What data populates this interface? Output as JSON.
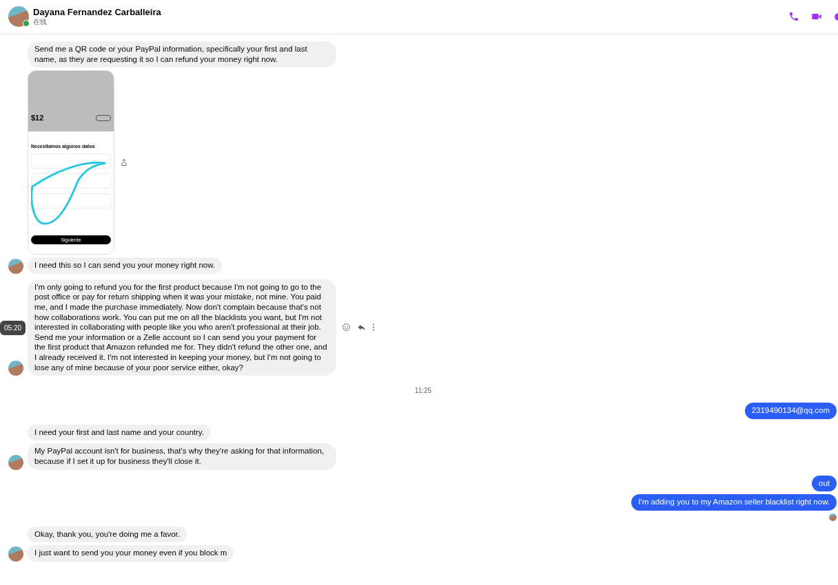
{
  "header": {
    "name": "Dayana Fernandez Carballeira",
    "status": "在线",
    "online": true
  },
  "messages": [
    {
      "kind": "text",
      "outgoing": false,
      "text": "Send me a QR code or your PayPal information, specifically your first and last name, as they are requesting it so I can refund your money right now.",
      "avatar": false
    },
    {
      "kind": "image",
      "outgoing": false,
      "price": "$12",
      "heading": "Necesitamos algunos datos",
      "button": "Siguiente",
      "avatar": false
    },
    {
      "kind": "text",
      "outgoing": false,
      "text": "I need this so I can send you your money right now.",
      "avatar": true
    },
    {
      "kind": "text",
      "outgoing": false,
      "text": "I'm only going to refund you for the first product because I'm not going to go to the post office or pay for return shipping when it was your mistake, not mine. You paid me, and I made the purchase immediately. Now don't complain because that's not how collaborations work. You can put me on all the blacklists you want, but I'm not interested in collaborating with people like you who aren't professional at their job. Send me your information or a Zelle account so I can send you your payment for the first product that Amazon refunded me for. They didn't refund the other one, and I already received it. I'm not interested in keeping your money, but I'm not going to lose any of mine because of your poor service either, okay?",
      "avatar": true,
      "hover_time": "05:20"
    },
    {
      "kind": "time",
      "text": "11:25"
    },
    {
      "kind": "text",
      "outgoing": true,
      "text": "2319490134@qq.com"
    },
    {
      "kind": "text",
      "outgoing": false,
      "text": "I need your first and last name and your country.",
      "avatar": false
    },
    {
      "kind": "text",
      "outgoing": false,
      "text": "My PayPal account isn't for business, that's why they're asking for that information, because if I set it up for business they'll close it.",
      "avatar": true
    },
    {
      "kind": "text",
      "outgoing": true,
      "text": "out"
    },
    {
      "kind": "text",
      "outgoing": true,
      "text": "I'm adding you to my Amazon seller blacklist right now."
    },
    {
      "kind": "seen"
    },
    {
      "kind": "text",
      "outgoing": false,
      "text": "Okay, thank you, you're doing me a favor.",
      "avatar": false
    },
    {
      "kind": "text",
      "outgoing": false,
      "text": "I just want to send you your money even if you block m",
      "avatar": true
    }
  ]
}
